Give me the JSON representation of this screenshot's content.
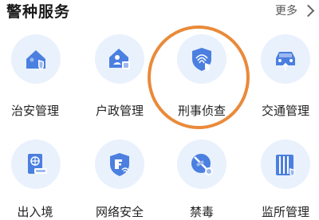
{
  "header": {
    "title": "警种服务",
    "more_label": "更多"
  },
  "items": [
    {
      "label": "治安管理"
    },
    {
      "label": "户政管理"
    },
    {
      "label": "刑事侦查"
    },
    {
      "label": "交通管理"
    },
    {
      "label": "出入境"
    },
    {
      "label": "网络安全"
    },
    {
      "label": "禁毒"
    },
    {
      "label": "监所管理"
    }
  ],
  "colors": {
    "accent": "#4b7fe0",
    "icon_bg": "#e9f1fd",
    "highlight": "#e98a3a"
  },
  "icons": [
    "house-shield-icon",
    "household-icon",
    "fingerprint-shield-icon",
    "car-icon",
    "passport-icon",
    "network-shield-icon",
    "no-drugs-icon",
    "prison-icon"
  ]
}
